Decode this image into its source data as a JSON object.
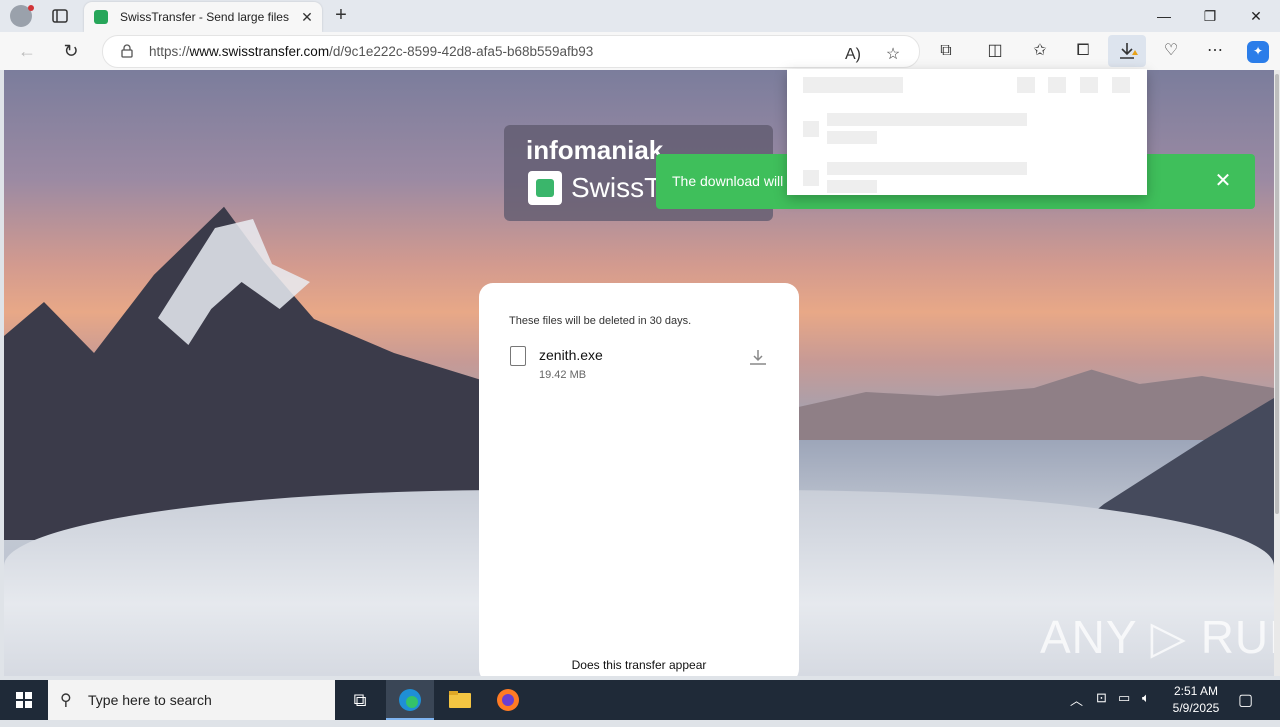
{
  "browser": {
    "tab_title": "SwissTransfer - Send large files se",
    "tab_close": "✕",
    "new_tab": "+",
    "url_prefix": "https://",
    "url_domain": "www.swisstransfer.com",
    "url_path": "/d/9c1e222c-8599-42d8-afa5-b68b559afb93",
    "window_controls": {
      "minimize": "—",
      "restore": "❐",
      "close": "✕"
    }
  },
  "page": {
    "brand_top": "infomaniak",
    "brand_name": "SwissTransfer",
    "toast_text": "The download will",
    "toast_close": "✕",
    "card": {
      "note": "These files will be deleted in 30 days.",
      "file_name": "zenith.exe",
      "file_size": "19.42 MB",
      "bottom_text": "Does this transfer appear"
    },
    "watermark": "ANY ▷ RUN"
  },
  "taskbar": {
    "search_placeholder": "Type here to search",
    "time": "2:51 AM",
    "date": "5/9/2025"
  },
  "colors": {
    "toast_green": "#3fbf5b",
    "brand_green": "#3ab66b",
    "taskbar_bg": "#1f2a38"
  }
}
